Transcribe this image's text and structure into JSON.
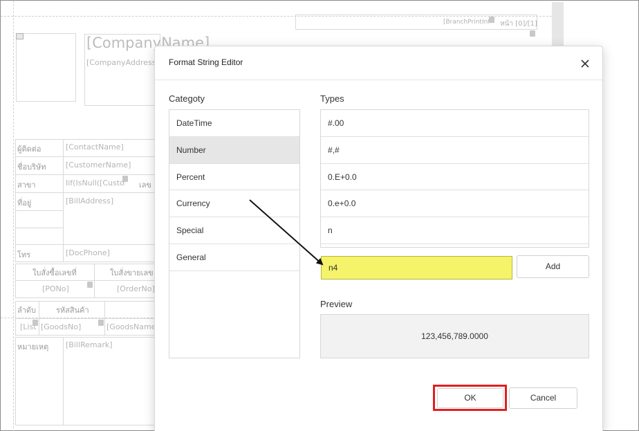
{
  "designer": {
    "company_name": "[CompanyName]",
    "company_address": "[CompanyAddress]",
    "branch_field": "[BranchPrintInf",
    "page_label": "หน้า [0]/[1]",
    "rows": [
      {
        "label": "ผู้ติดต่อ",
        "value": "[ContactName]"
      },
      {
        "label": "ชื่อบริษัท",
        "value": "[CustomerName]"
      },
      {
        "label": "สาขา",
        "value": "Iif(IsNull([Custom"
      },
      {
        "label": "ที่อยู่",
        "value": "[BillAddress]"
      },
      {
        "label": "โทร",
        "value": "[DocPhone]"
      }
    ],
    "branch_right_label": "เลข",
    "po_header": "ใบสั่งซื้อเลขที่",
    "order_header": "ใบสั่งขายเลข",
    "po_value": "[PONo]",
    "order_value": "[OrderNo]",
    "item_col1": "ลำดับ",
    "item_col2": "รหัสสินค้า",
    "list_value": "[List",
    "goods_no": "[GoodsNo]",
    "goods_name": "[GoodsName]",
    "remark_label": "หมายเหตุ",
    "remark_value": "[BillRemark]"
  },
  "dialog": {
    "title": "Format String Editor",
    "category_label": "Categoty",
    "types_label": "Types",
    "categories": [
      {
        "label": "DateTime",
        "selected": false
      },
      {
        "label": "Number",
        "selected": true
      },
      {
        "label": "Percent",
        "selected": false
      },
      {
        "label": "Currency",
        "selected": false
      },
      {
        "label": "Special",
        "selected": false
      },
      {
        "label": "General",
        "selected": false
      }
    ],
    "types": [
      "#.00",
      "#,#",
      "0.E+0.0",
      "0.e+0.0",
      "n"
    ],
    "format_input_value": "n4",
    "add_label": "Add",
    "preview_label": "Preview",
    "preview_value": "123,456,789.0000",
    "ok_label": "OK",
    "cancel_label": "Cancel"
  },
  "colors": {
    "input_highlight": "#f4f36a",
    "ok_outline": "#e02020",
    "selected_row": "#e6e6e6"
  },
  "icons": {
    "close": "close-icon",
    "arrow": "annotation-arrow"
  }
}
